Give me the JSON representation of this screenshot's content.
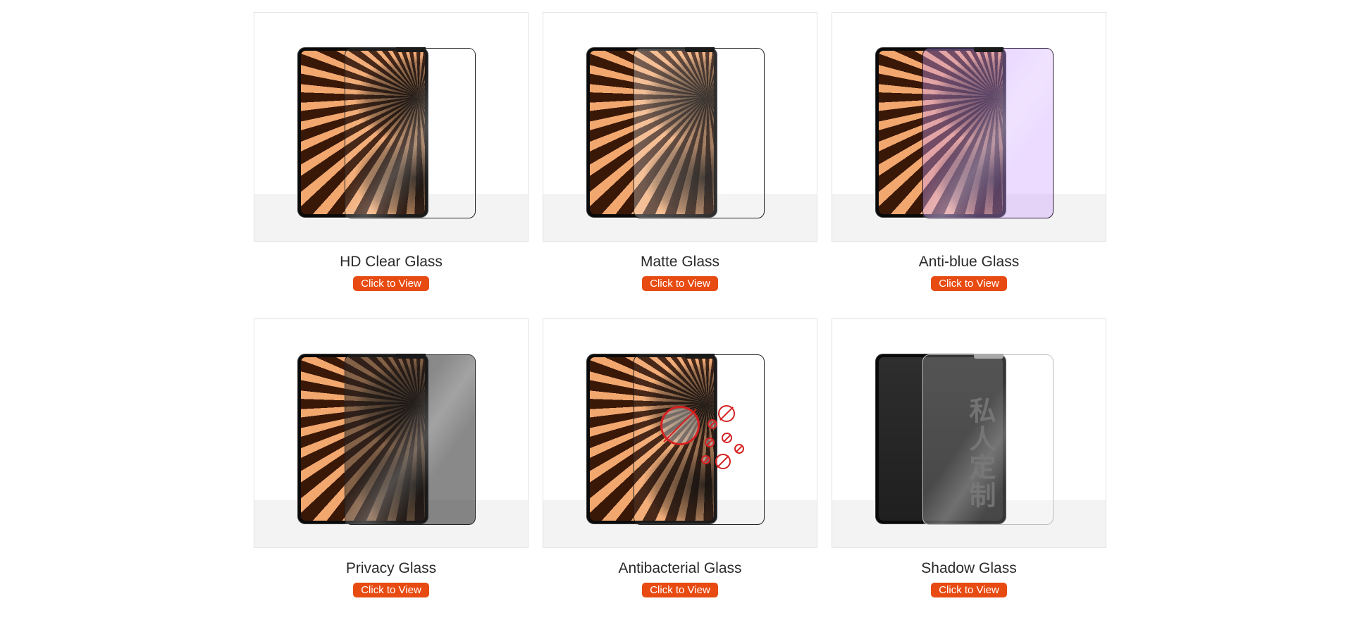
{
  "products": [
    {
      "name": "HD Clear Glass",
      "button": "Click to View"
    },
    {
      "name": "Matte Glass",
      "button": "Click to View"
    },
    {
      "name": "Anti-blue Glass",
      "button": "Click to View"
    },
    {
      "name": "Privacy Glass",
      "button": "Click to View"
    },
    {
      "name": "Antibacterial Glass",
      "button": "Click to View"
    },
    {
      "name": "Shadow Glass",
      "button": "Click to View"
    }
  ],
  "shadow_watermark": "私人定制",
  "colors": {
    "button": "#e74b12",
    "antiblue_tint": "#cda0ff",
    "frame_border": "#e2e2e2"
  }
}
